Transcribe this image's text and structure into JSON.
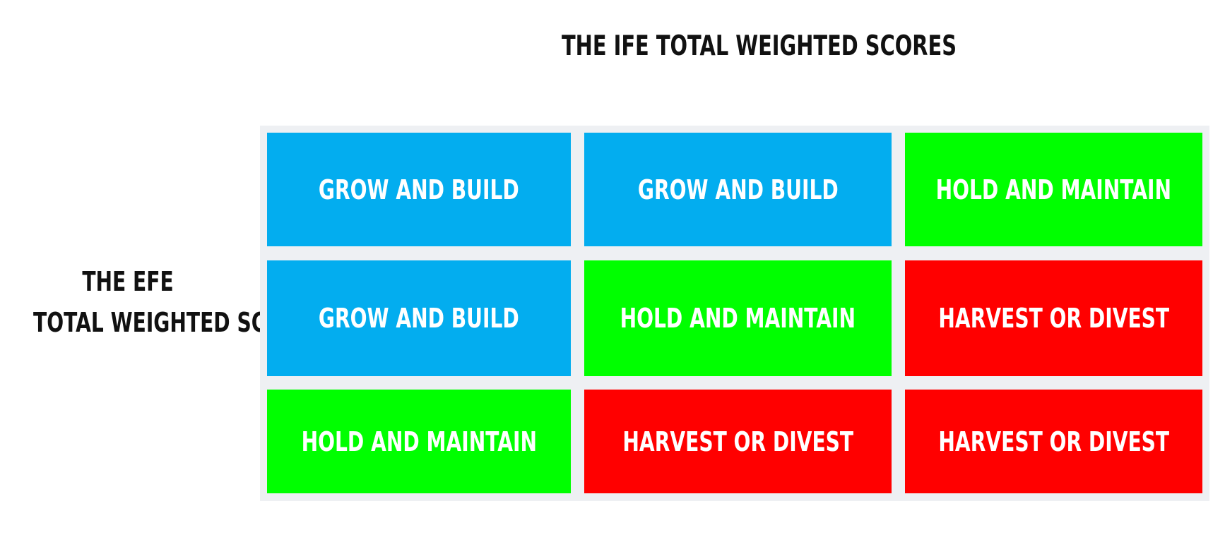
{
  "title": "THE IFE TOTAL WEIGHTED SCORES",
  "side_label": {
    "line1": "THE EFE",
    "line2": "TOTAL WEIGHTED SCORES"
  },
  "colors": {
    "grow": "#03adef",
    "hold": "#00ff00",
    "harvest": "#ff0000",
    "grid_bg": "#eef0f3",
    "cell_text": "#ffffff"
  },
  "matrix": {
    "rows": [
      {
        "cells": [
          {
            "label": "GROW AND BUILD",
            "strategy": "grow"
          },
          {
            "label": "GROW AND BUILD",
            "strategy": "grow"
          },
          {
            "label": "HOLD AND MAINTAIN",
            "strategy": "hold"
          }
        ]
      },
      {
        "cells": [
          {
            "label": "GROW AND BUILD",
            "strategy": "grow"
          },
          {
            "label": "HOLD AND MAINTAIN",
            "strategy": "hold"
          },
          {
            "label": "HARVEST OR DIVEST",
            "strategy": "harvest"
          }
        ]
      },
      {
        "cells": [
          {
            "label": "HOLD AND MAINTAIN",
            "strategy": "hold"
          },
          {
            "label": "HARVEST OR DIVEST",
            "strategy": "harvest"
          },
          {
            "label": "HARVEST OR DIVEST",
            "strategy": "harvest"
          }
        ]
      }
    ]
  }
}
